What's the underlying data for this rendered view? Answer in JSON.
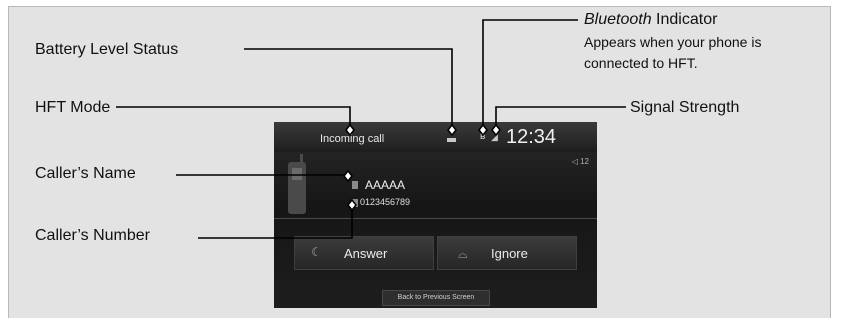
{
  "callouts": {
    "battery_level_status": "Battery Level Status",
    "hft_mode": "HFT Mode",
    "callers_name": "Caller’s Name",
    "callers_number": "Caller’s Number",
    "bluetooth_indicator_italic": "Bluetooth",
    "bluetooth_indicator_rest": " Indicator",
    "bluetooth_note_line1": "Appears when your phone is",
    "bluetooth_note_line2": "connected to HFT.",
    "signal_strength": "Signal Strength"
  },
  "screen": {
    "mode_label": "Incoming call",
    "clock": "12:34",
    "volume_indicator": "◁ 12",
    "caller_name": "AAAAA",
    "caller_number": "0123456789",
    "answer_label": "Answer",
    "ignore_label": "Ignore",
    "back_label": "Back to Previous Screen",
    "bluetooth_glyph": "ʙ",
    "signal_glyph": "◢"
  },
  "icons": {
    "phone": "mobile-phone-icon",
    "answer": "handset-icon",
    "ignore": "hang-up-icon",
    "battery": "battery-icon",
    "bluetooth": "bluetooth-icon",
    "signal": "signal-strength-icon",
    "contact": "contact-icon",
    "number": "number-icon"
  },
  "colors": {
    "frame_bg": "#e3e3e3",
    "screen_bg": "#161616",
    "leader": "#000000"
  }
}
